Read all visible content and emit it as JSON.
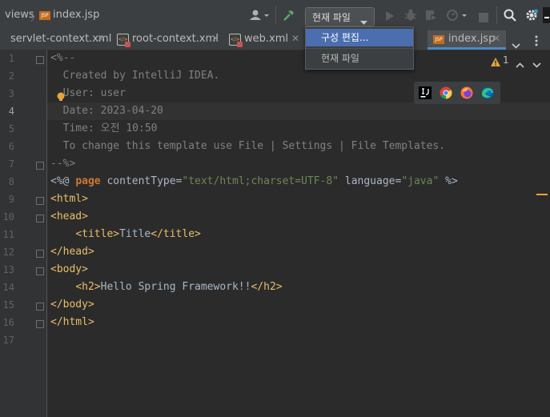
{
  "breadcrumb": {
    "folder": "views",
    "file": "index.jsp",
    "file_icon": "JSP"
  },
  "toolbar": {
    "config_label": "현재 파일"
  },
  "config_menu": {
    "items": [
      "구성 편집...",
      "현재 파일"
    ]
  },
  "tabs": [
    {
      "label": "servlet-context.xml"
    },
    {
      "label": "root-context.xml"
    },
    {
      "label": "web.xml"
    },
    {
      "label": "index.jsp",
      "active": true
    }
  ],
  "inspection": {
    "warning_count": "1",
    "warning_color": "#e8a33b"
  },
  "gutter": {
    "line_numbers": [
      "1",
      "2",
      "3",
      "4",
      "5",
      "6",
      "7",
      "8",
      "9",
      "10",
      "11",
      "12",
      "13",
      "14",
      "15",
      "16",
      "17"
    ],
    "current_line": "4"
  },
  "code": {
    "l1": "<%--",
    "l2": "  Created by IntelliJ IDEA.",
    "l3": "  User: user",
    "l4": "  Date: 2023-04-20",
    "l5": "  Time: 오전 10:50",
    "l6": "  To change this template use File | Settings | File Templates.",
    "l7": "--%>",
    "l8": {
      "open": "<%@ ",
      "kw": "page",
      "attr1": " contentType=",
      "val1": "\"text/html;charset=UTF-8\"",
      "attr2": " language=",
      "val2": "\"java\"",
      "close": " %>"
    },
    "l9": "<html>",
    "l10": "<head>",
    "l11": {
      "indent": "    ",
      "open": "<title>",
      "text": "Title",
      "close": "</title>"
    },
    "l12": "</head>",
    "l13": "<body>",
    "l14": {
      "indent": "    ",
      "open": "<h2>",
      "text": "Hello Spring Framework!!",
      "close": "</h2>"
    },
    "l15": "</body>",
    "l16": "</html>"
  },
  "colors": {
    "accent": "#4a88c7",
    "menu_selection": "#4b6eaf",
    "editor_bg": "#2b2b2b"
  }
}
